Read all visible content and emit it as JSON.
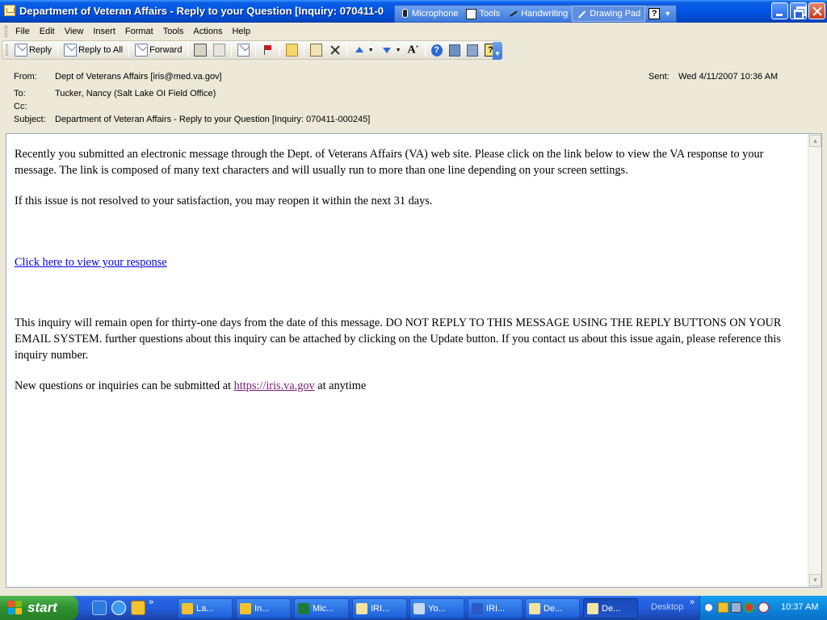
{
  "window": {
    "title": "Department of Veteran Affairs - Reply to your Question [Inquiry: 070411-0",
    "language_bar": {
      "microphone": "Microphone",
      "tools": "Tools",
      "handwriting": "Handwriting",
      "drawing_pad": "Drawing Pad",
      "help": "?"
    }
  },
  "menu": [
    "File",
    "Edit",
    "View",
    "Insert",
    "Format",
    "Tools",
    "Actions",
    "Help"
  ],
  "toolbar": {
    "reply": "Reply",
    "reply_all": "Reply to All",
    "forward": "Forward"
  },
  "header": {
    "from_label": "From:",
    "from_value": "Dept of Veterans Affairs [iris@med.va.gov]",
    "to_label": "To:",
    "to_value": "Tucker, Nancy (Salt Lake OI Field Office)",
    "cc_label": "Cc:",
    "cc_value": "",
    "subject_label": "Subject:",
    "subject_value": "Department of Veteran Affairs - Reply to your Question [Inquiry: 070411-000245]",
    "sent_label": "Sent:",
    "sent_value": "Wed 4/11/2007 10:36 AM"
  },
  "body": {
    "para1": "Recently you submitted an electronic message through the Dept. of Veterans Affairs (VA) web site. Please click on the link below to view the VA response to your message. The link is composed of many text characters and will usually run to more than one line depending on your screen settings.",
    "para2": "If this issue is not resolved to your satisfaction, you may reopen it within the next 31 days.",
    "link_text": "Click here to view your response",
    "para3": "This inquiry will remain open for thirty-one days from the date of this message. DO NOT REPLY TO THIS MESSAGE USING THE REPLY BUTTONS ON YOUR EMAIL SYSTEM. further questions about this inquiry can be attached by clicking on the Update button. If you contact us about this issue again, please reference this inquiry number.",
    "para4_before": "New questions or inquiries can be submitted at ",
    "para4_link": "https://iris.va.gov",
    "para4_after": " at anytime"
  },
  "taskbar": {
    "start": "start",
    "tasks": [
      "La...",
      "In...",
      "Mic...",
      "IRI...",
      "Yo...",
      "IRI...",
      "De...",
      "De..."
    ],
    "desktop": "Desktop",
    "clock": "10:37 AM"
  }
}
